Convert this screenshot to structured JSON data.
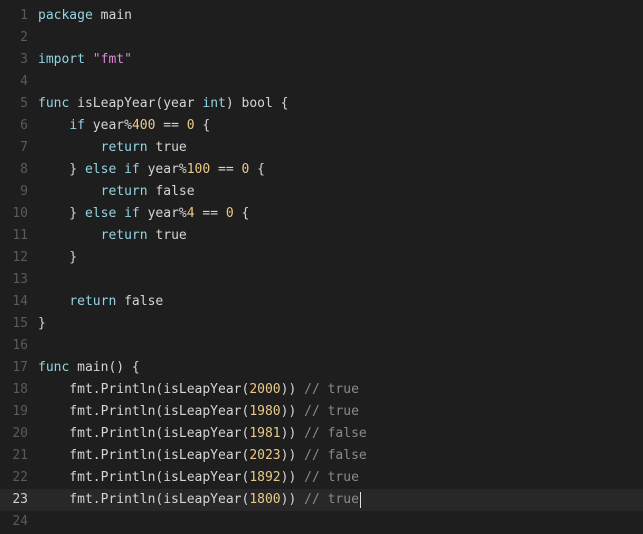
{
  "editor": {
    "language": "go",
    "active_line": 23,
    "colors": {
      "background": "#1e1e1e",
      "active_line": "#282828",
      "keyword": "#94d3e3",
      "string": "#d98ad6",
      "number": "#e8c98a",
      "comment": "#8a8a8a",
      "line_number": "#5a5a5a"
    },
    "lines": [
      {
        "n": "1",
        "tokens": [
          [
            "keyword",
            "package"
          ],
          [
            "ident",
            " main"
          ]
        ]
      },
      {
        "n": "2",
        "tokens": []
      },
      {
        "n": "3",
        "tokens": [
          [
            "keyword",
            "import"
          ],
          [
            "ident",
            " "
          ],
          [
            "string",
            "\"fmt\""
          ]
        ]
      },
      {
        "n": "4",
        "tokens": []
      },
      {
        "n": "5",
        "tokens": [
          [
            "keyword",
            "func"
          ],
          [
            "ident",
            " isLeapYear(year "
          ],
          [
            "keyword",
            "int"
          ],
          [
            "ident",
            ") bool {"
          ]
        ]
      },
      {
        "n": "6",
        "tokens": [
          [
            "ident",
            "    "
          ],
          [
            "keyword",
            "if"
          ],
          [
            "ident",
            " year%"
          ],
          [
            "number",
            "400"
          ],
          [
            "ident",
            " == "
          ],
          [
            "number",
            "0"
          ],
          [
            "ident",
            " {"
          ]
        ]
      },
      {
        "n": "7",
        "tokens": [
          [
            "ident",
            "        "
          ],
          [
            "keyword",
            "return"
          ],
          [
            "ident",
            " true"
          ]
        ]
      },
      {
        "n": "8",
        "tokens": [
          [
            "ident",
            "    } "
          ],
          [
            "keyword",
            "else if"
          ],
          [
            "ident",
            " year%"
          ],
          [
            "number",
            "100"
          ],
          [
            "ident",
            " == "
          ],
          [
            "number",
            "0"
          ],
          [
            "ident",
            " {"
          ]
        ]
      },
      {
        "n": "9",
        "tokens": [
          [
            "ident",
            "        "
          ],
          [
            "keyword",
            "return"
          ],
          [
            "ident",
            " false"
          ]
        ]
      },
      {
        "n": "10",
        "tokens": [
          [
            "ident",
            "    } "
          ],
          [
            "keyword",
            "else if"
          ],
          [
            "ident",
            " year%"
          ],
          [
            "number",
            "4"
          ],
          [
            "ident",
            " == "
          ],
          [
            "number",
            "0"
          ],
          [
            "ident",
            " {"
          ]
        ]
      },
      {
        "n": "11",
        "tokens": [
          [
            "ident",
            "        "
          ],
          [
            "keyword",
            "return"
          ],
          [
            "ident",
            " true"
          ]
        ]
      },
      {
        "n": "12",
        "tokens": [
          [
            "ident",
            "    }"
          ]
        ]
      },
      {
        "n": "13",
        "tokens": []
      },
      {
        "n": "14",
        "tokens": [
          [
            "ident",
            "    "
          ],
          [
            "keyword",
            "return"
          ],
          [
            "ident",
            " false"
          ]
        ]
      },
      {
        "n": "15",
        "tokens": [
          [
            "ident",
            "}"
          ]
        ]
      },
      {
        "n": "16",
        "tokens": []
      },
      {
        "n": "17",
        "tokens": [
          [
            "keyword",
            "func"
          ],
          [
            "ident",
            " main() {"
          ]
        ]
      },
      {
        "n": "18",
        "tokens": [
          [
            "ident",
            "    fmt.Println(isLeapYear("
          ],
          [
            "number",
            "2000"
          ],
          [
            "ident",
            ")) "
          ],
          [
            "comment",
            "// true"
          ]
        ]
      },
      {
        "n": "19",
        "tokens": [
          [
            "ident",
            "    fmt.Println(isLeapYear("
          ],
          [
            "number",
            "1980"
          ],
          [
            "ident",
            ")) "
          ],
          [
            "comment",
            "// true"
          ]
        ]
      },
      {
        "n": "20",
        "tokens": [
          [
            "ident",
            "    fmt.Println(isLeapYear("
          ],
          [
            "number",
            "1981"
          ],
          [
            "ident",
            ")) "
          ],
          [
            "comment",
            "// false"
          ]
        ]
      },
      {
        "n": "21",
        "tokens": [
          [
            "ident",
            "    fmt.Println(isLeapYear("
          ],
          [
            "number",
            "2023"
          ],
          [
            "ident",
            ")) "
          ],
          [
            "comment",
            "// false"
          ]
        ]
      },
      {
        "n": "22",
        "tokens": [
          [
            "ident",
            "    fmt.Println(isLeapYear("
          ],
          [
            "number",
            "1892"
          ],
          [
            "ident",
            ")) "
          ],
          [
            "comment",
            "// true"
          ]
        ]
      },
      {
        "n": "23",
        "tokens": [
          [
            "ident",
            "    fmt.Println(isLeapYear("
          ],
          [
            "number",
            "1800"
          ],
          [
            "ident",
            ")) "
          ],
          [
            "comment",
            "// true"
          ]
        ]
      },
      {
        "n": "24",
        "tokens": []
      }
    ]
  }
}
